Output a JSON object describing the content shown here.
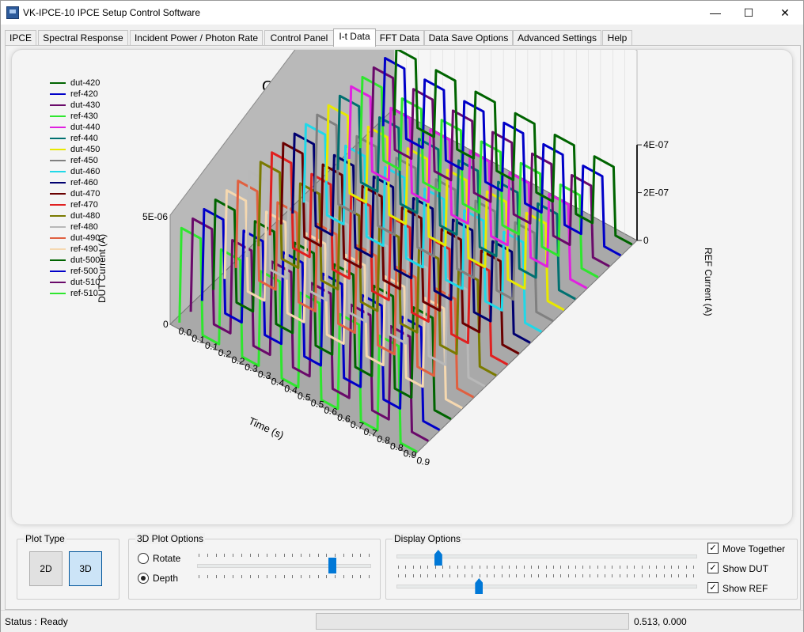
{
  "window": {
    "title": "VK-IPCE-10 IPCE Setup Control Software",
    "minimize_glyph": "—",
    "maximize_glyph": "☐",
    "close_glyph": "✕"
  },
  "tabs": [
    {
      "label": "IPCE"
    },
    {
      "label": "Spectral Response"
    },
    {
      "label": "Incident Power / Photon Rate"
    },
    {
      "label": "Control Panel"
    },
    {
      "label": "I-t Data",
      "active": true
    },
    {
      "label": "FFT Data"
    },
    {
      "label": "Data Save Options"
    },
    {
      "label": "Advanced Settings"
    },
    {
      "label": "Help"
    }
  ],
  "chart_data": {
    "type": "line",
    "title": "Current vs. Time Data for DUT and REF",
    "xlabel": "Time (s)",
    "ylabel_left": "DUT Current (A)",
    "ylabel_right": "REF Current (A)",
    "x_ticks": [
      "0.0",
      "0.1",
      "0.1",
      "0.2",
      "0.2",
      "0.3",
      "0.3",
      "0.4",
      "0.4",
      "0.5",
      "0.5",
      "0.6",
      "0.6",
      "0.7",
      "0.7",
      "0.8",
      "0.8",
      "0.9",
      "0.9"
    ],
    "y_left_ticks": [
      "0",
      "5E-06"
    ],
    "y_right_ticks": [
      "0",
      "2E-07",
      "4E-07"
    ],
    "legend_placement": "top-left",
    "waveform": "square pulse train, 6 pulses per series over 0.0-0.9 s",
    "series": [
      {
        "name": "dut-420",
        "color": "#006400"
      },
      {
        "name": "ref-420",
        "color": "#0000c8"
      },
      {
        "name": "dut-430",
        "color": "#6a0a6a"
      },
      {
        "name": "ref-430",
        "color": "#2ee62e"
      },
      {
        "name": "dut-440",
        "color": "#e020e0"
      },
      {
        "name": "ref-440",
        "color": "#007070"
      },
      {
        "name": "dut-450",
        "color": "#e8e800"
      },
      {
        "name": "ref-450",
        "color": "#808080"
      },
      {
        "name": "dut-460",
        "color": "#20d8e8"
      },
      {
        "name": "ref-460",
        "color": "#000070"
      },
      {
        "name": "dut-470",
        "color": "#6a0000"
      },
      {
        "name": "ref-470",
        "color": "#e02020"
      },
      {
        "name": "dut-480",
        "color": "#7a7a00"
      },
      {
        "name": "ref-480",
        "color": "#b8b8b8"
      },
      {
        "name": "dut-490",
        "color": "#e06040"
      },
      {
        "name": "ref-490",
        "color": "#f5d8b0"
      },
      {
        "name": "dut-500",
        "color": "#006400"
      },
      {
        "name": "ref-500",
        "color": "#0000c8"
      },
      {
        "name": "dut-510",
        "color": "#6a0a6a"
      },
      {
        "name": "ref-510",
        "color": "#2ee62e"
      }
    ]
  },
  "controls": {
    "plot_type": {
      "label": "Plot Type",
      "btn_2d": "2D",
      "btn_3d": "3D",
      "selected": "3D"
    },
    "options_3d": {
      "label": "3D Plot Options",
      "rotate": "Rotate",
      "depth": "Depth",
      "selected": "Depth",
      "slider_value": 0.8
    },
    "display": {
      "label": "Display Options",
      "slider1_value": 0.13,
      "slider2_value": 0.27,
      "move_together": "Move Together",
      "show_dut": "Show DUT",
      "show_ref": "Show REF",
      "move_together_checked": true,
      "show_dut_checked": true,
      "show_ref_checked": true
    }
  },
  "status": {
    "label": "Status :",
    "value": "Ready",
    "coords": "0.513, 0.000"
  }
}
